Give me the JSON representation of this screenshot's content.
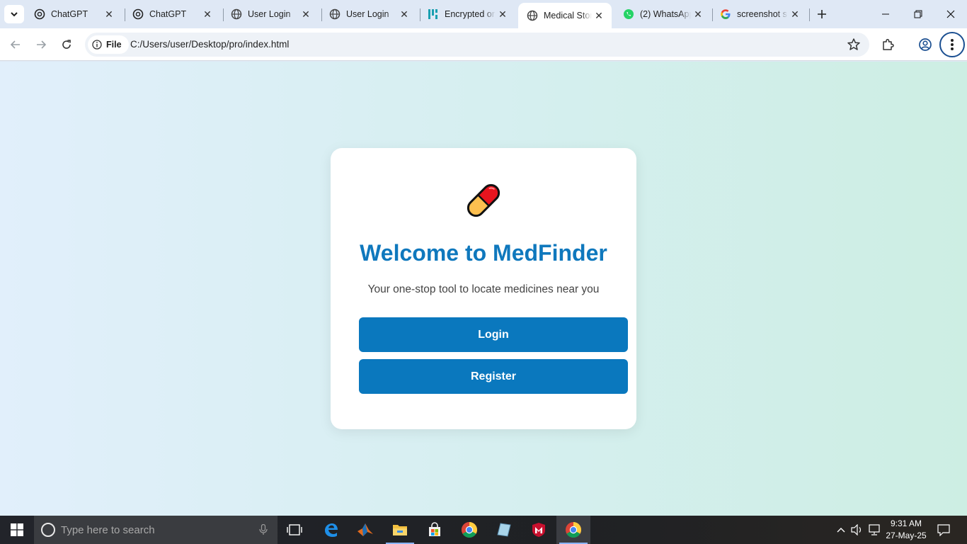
{
  "tabs": [
    {
      "title": "ChatGPT",
      "icon": "chatgpt-icon",
      "active": false
    },
    {
      "title": "ChatGPT",
      "icon": "chatgpt-icon",
      "active": false
    },
    {
      "title": "User Login",
      "icon": "globe-icon",
      "active": false
    },
    {
      "title": "User Login",
      "icon": "globe-icon",
      "active": false
    },
    {
      "title": "Encrypted or",
      "icon": "encrypted-app-icon",
      "active": false
    },
    {
      "title": "Medical Stor",
      "icon": "globe-icon",
      "active": true
    },
    {
      "title": "(2) WhatsApp",
      "icon": "whatsapp-icon",
      "active": false
    },
    {
      "title": "screenshot s",
      "icon": "google-icon",
      "active": false
    }
  ],
  "toolbar": {
    "site_chip": "File",
    "url": "C:/Users/user/Desktop/pro/index.html"
  },
  "page": {
    "heading": "Welcome to MedFinder",
    "tagline": "Your one-stop tool to locate medicines near you",
    "login_label": "Login",
    "register_label": "Register",
    "accent_color": "#0a78be"
  },
  "taskbar": {
    "search_placeholder": "Type here to search",
    "time": "9:31 AM",
    "date": "27-May-25"
  }
}
